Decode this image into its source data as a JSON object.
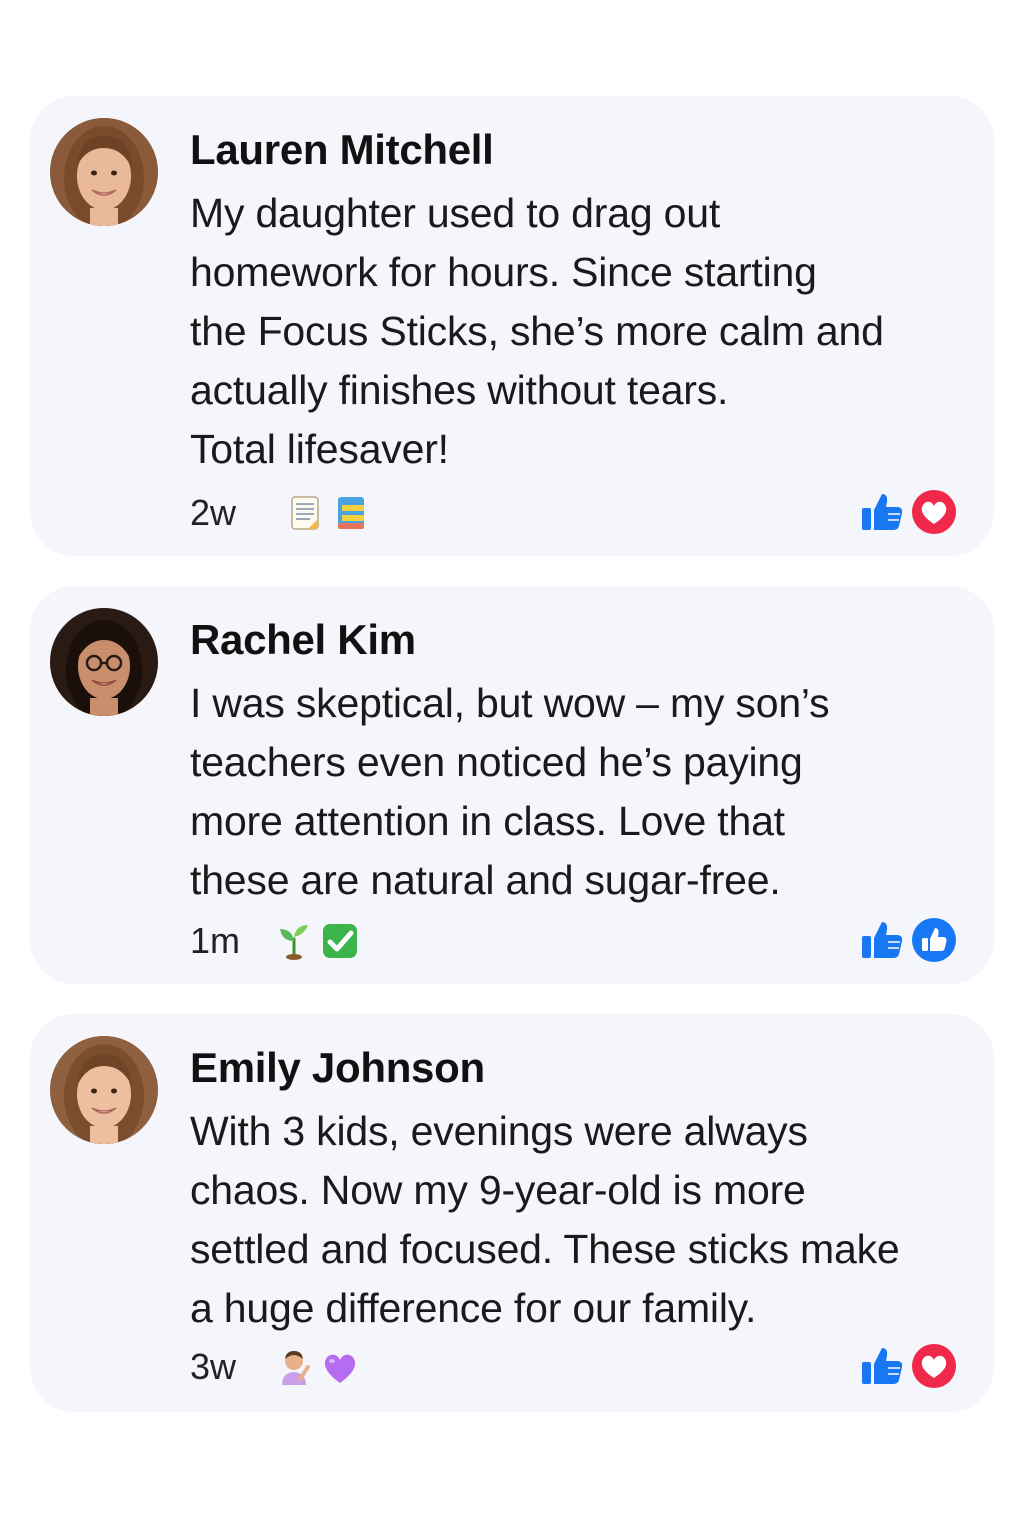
{
  "comments": [
    {
      "author": "Lauren Mitchell",
      "text": "My daughter used to drag out\nhomework for hours. Since starting\nthe Focus Sticks, she’s more calm and\nactually finishes without tears.\nTotal lifesaver!",
      "time": "2w",
      "emojis": [
        "memo-icon",
        "notebook-icon"
      ],
      "reactions": [
        "like-icon",
        "love-icon"
      ]
    },
    {
      "author": "Rachel Kim",
      "text": "I was skeptical, but wow – my son’s\nteachers even noticed he’s paying\nmore attention in class. Love that\nthese are natural and sugar-free.",
      "time": "1m",
      "emojis": [
        "seedling-icon",
        "check-mark-icon"
      ],
      "reactions": [
        "like-icon",
        "like-badge-icon"
      ]
    },
    {
      "author": "Emily Johnson",
      "text": "With 3 kids, evenings were always\nchaos. Now my 9-year-old is more\nsettled and focused. These sticks make\na huge difference for our family.",
      "time": "3w",
      "emojis": [
        "person-raising-hand-icon",
        "purple-heart-icon"
      ],
      "reactions": [
        "like-icon",
        "love-icon"
      ]
    }
  ],
  "colors": {
    "card_background": "#f4f6fb",
    "like_blue": "#1877f2",
    "love_red": "#f02849",
    "check_green": "#3bb54a",
    "heart_purple": "#b56cf0"
  }
}
